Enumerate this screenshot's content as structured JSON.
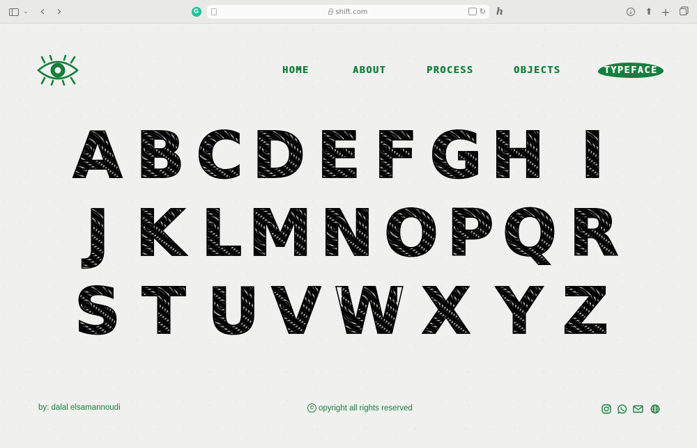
{
  "browser": {
    "url": "shift.com",
    "extension_letter": "h",
    "grammarly_letter": "G",
    "icons": [
      "sidebar-icon",
      "chevron-down-icon",
      "back-icon",
      "forward-icon",
      "grammarly-icon",
      "page-icon",
      "lock-icon",
      "translate-icon",
      "reload-icon",
      "extension-icon",
      "download-icon",
      "share-icon",
      "new-tab-icon",
      "tabs-overview-icon"
    ]
  },
  "nav": {
    "items": [
      {
        "label": "HOME"
      },
      {
        "label": "ABOUT"
      },
      {
        "label": "PROCESS"
      },
      {
        "label": "OBJECTS"
      },
      {
        "label": "TYPEFACE",
        "active": true
      }
    ]
  },
  "alphabet": {
    "rows": [
      [
        "A",
        "B",
        "C",
        "D",
        "E",
        "F",
        "G",
        "H",
        "I"
      ],
      [
        "J",
        "K",
        "L",
        "M",
        "N",
        "O",
        "P",
        "Q",
        "R"
      ],
      [
        "S",
        "T",
        "U",
        "V",
        "W",
        "X",
        "Y",
        "Z"
      ]
    ]
  },
  "footer": {
    "credit": "by: dalal elsamannoudi",
    "copyright_symbol": "C",
    "copyright": "opyright all rights reserved",
    "social_icons": [
      "instagram-icon",
      "whatsapp-icon",
      "mail-icon",
      "globe-icon"
    ]
  },
  "colors": {
    "accent": "#157f3d",
    "background": "#f0f0ee",
    "glyph_ink": "#111111"
  }
}
